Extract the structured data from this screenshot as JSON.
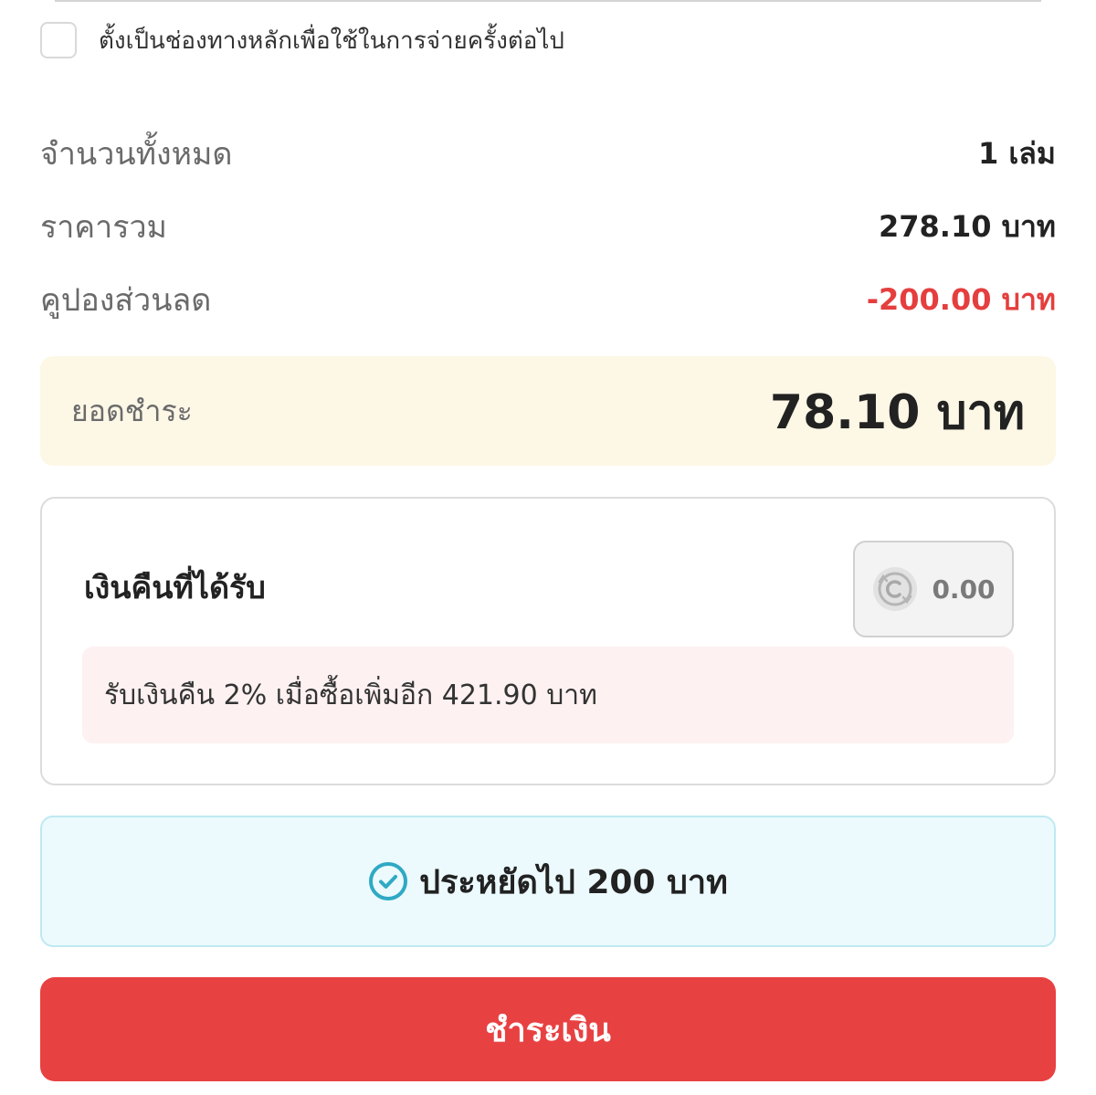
{
  "payment_method": {
    "set_default_label": "ตั้งเป็นช่องทางหลักเพื่อใช้ในการจ่ายครั้งต่อไป",
    "set_default_checked": false
  },
  "summary": {
    "quantity_label": "จำนวนทั้งหมด",
    "quantity_value": "1 เล่ม",
    "subtotal_label": "ราคารวม",
    "subtotal_value": "278.10 บาท",
    "coupon_label": "คูปองส่วนลด",
    "coupon_value": "-200.00 บาท"
  },
  "total": {
    "label": "ยอดชำระ",
    "value": "78.10 บาท"
  },
  "cashback": {
    "title": "เงินคืนที่ได้รับ",
    "icon": "coin-cashback-icon",
    "amount": "0.00",
    "hint": "รับเงินคืน 2% เมื่อซื้อเพิ่มอีก 421.90 บาท"
  },
  "savings": {
    "icon": "check-circle-icon",
    "text": "ประหยัดไป 200 บาท"
  },
  "pay_button": {
    "label": "ชำระเงิน"
  },
  "colors": {
    "primary": "#e84142",
    "discount": "#e53e3e",
    "total_bg": "#fdf7e6",
    "hint_bg": "#fdf1f1",
    "savings_bg": "#ecfafd",
    "savings_icon": "#2fa9c4"
  }
}
